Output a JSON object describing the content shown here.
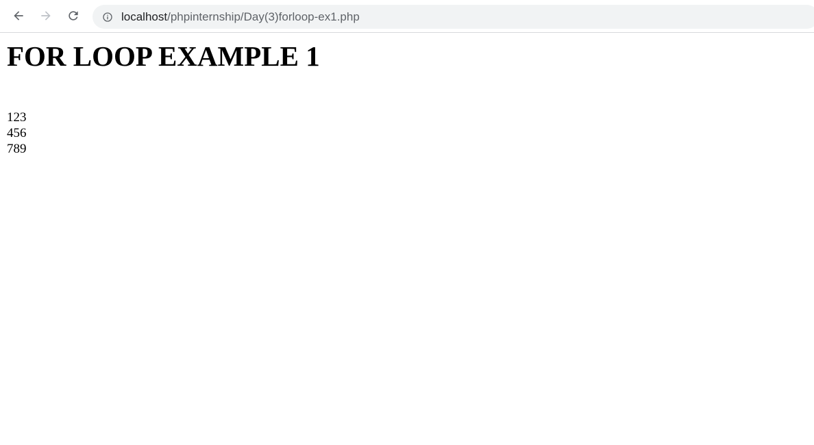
{
  "browser": {
    "url_host": "localhost",
    "url_path": "/phpinternship/Day(3)forloop-ex1.php",
    "icons": {
      "back": "arrow-left-icon",
      "forward": "arrow-right-icon",
      "reload": "reload-icon",
      "info": "info-icon"
    },
    "colors": {
      "omnibox_bg": "#f1f3f4",
      "host_text": "#202124",
      "path_text": "#5f6368",
      "icon_active": "#5f6368",
      "icon_disabled": "#bdc1c6"
    }
  },
  "page": {
    "heading": "FOR LOOP EXAMPLE 1",
    "lines": [
      "123",
      "456",
      "789"
    ]
  }
}
